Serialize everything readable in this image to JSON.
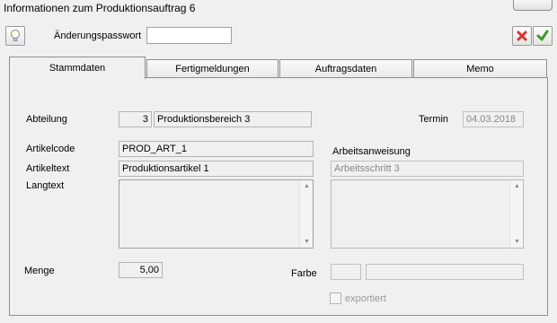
{
  "window": {
    "title": "Informationen zum Produktionsauftrag 6"
  },
  "toolbar": {
    "password_label": "Änderungspasswort",
    "password_value": ""
  },
  "tabs": [
    {
      "label": "Stammdaten",
      "active": true
    },
    {
      "label": "Fertigmeldungen",
      "active": false
    },
    {
      "label": "Auftragsdaten",
      "active": false
    },
    {
      "label": "Memo",
      "active": false
    }
  ],
  "form": {
    "abteilung_label": "Abteilung",
    "abteilung_nr": "3",
    "abteilung_name": "Produktionsbereich 3",
    "termin_label": "Termin",
    "termin_value": "04.03.2018",
    "artikelcode_label": "Artikelcode",
    "artikelcode_value": "PROD_ART_1",
    "artikeltext_label": "Artikeltext",
    "artikeltext_value": "Produktionsartikel 1",
    "langtext_label": "Langtext",
    "langtext_value": "",
    "arbeitsanweisung_label": "Arbeitsanweisung",
    "arbeitsanweisung_value": "Arbeitsschritt 3",
    "arbeitsanweisung_text": "",
    "menge_label": "Menge",
    "menge_value": "5,00",
    "farbe_label": "Farbe",
    "farbe_code": "",
    "farbe_name": "",
    "exportiert_label": "exportiert",
    "exportiert_checked": false
  },
  "colors": {
    "cancel_red": "#d9342b",
    "ok_green": "#3c9a2a"
  }
}
